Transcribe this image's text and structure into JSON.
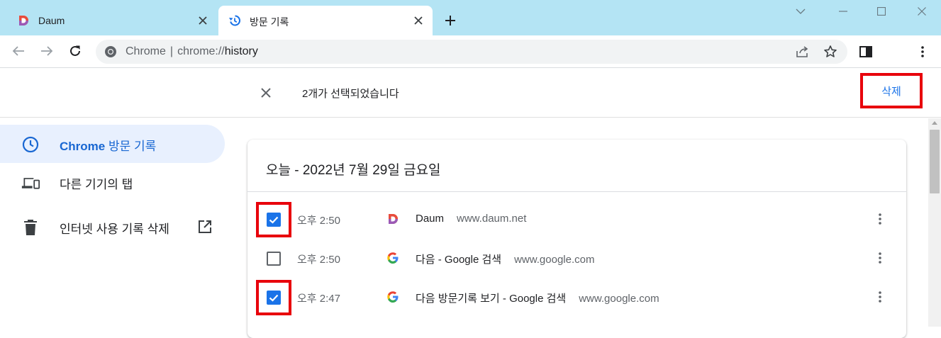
{
  "tabs": [
    {
      "title": "Daum",
      "icon": "daum-favicon-icon",
      "active": false
    },
    {
      "title": "방문 기록",
      "icon": "history-icon",
      "active": true
    }
  ],
  "toolbar": {
    "omnibox_site": "Chrome",
    "omnibox_url_scheme": "chrome://",
    "omnibox_url_host": "history"
  },
  "selection": {
    "text": "2개가 선택되었습니다",
    "delete_label": "삭제"
  },
  "sidebar": {
    "items": [
      {
        "label_bold": "Chrome",
        "label_rest": " 방문 기록",
        "icon": "clock-icon",
        "active": true
      },
      {
        "label": "다른 기기의 탭",
        "icon": "devices-icon",
        "active": false
      },
      {
        "label": "인터넷 사용 기록 삭제",
        "icon": "trash-icon",
        "external_icon": "open-in-new-icon",
        "active": false
      }
    ]
  },
  "history": {
    "day_title": "오늘 - 2022년 7월 29일 금요일",
    "rows": [
      {
        "time": "오후 2:50",
        "title": "Daum",
        "domain": "www.daum.net",
        "checked": true,
        "favicon": "daum-favicon-icon"
      },
      {
        "time": "오후 2:50",
        "title": "다음 - Google 검색",
        "domain": "www.google.com",
        "checked": false,
        "favicon": "google-favicon-icon"
      },
      {
        "time": "오후 2:47",
        "title": "다음 방문기록 보기 - Google 검색",
        "domain": "www.google.com",
        "checked": true,
        "favicon": "google-favicon-icon"
      }
    ]
  },
  "colors": {
    "tabstrip": "#b4e4f4",
    "accent": "#1a73e8",
    "highlight_box": "#e8000b"
  }
}
